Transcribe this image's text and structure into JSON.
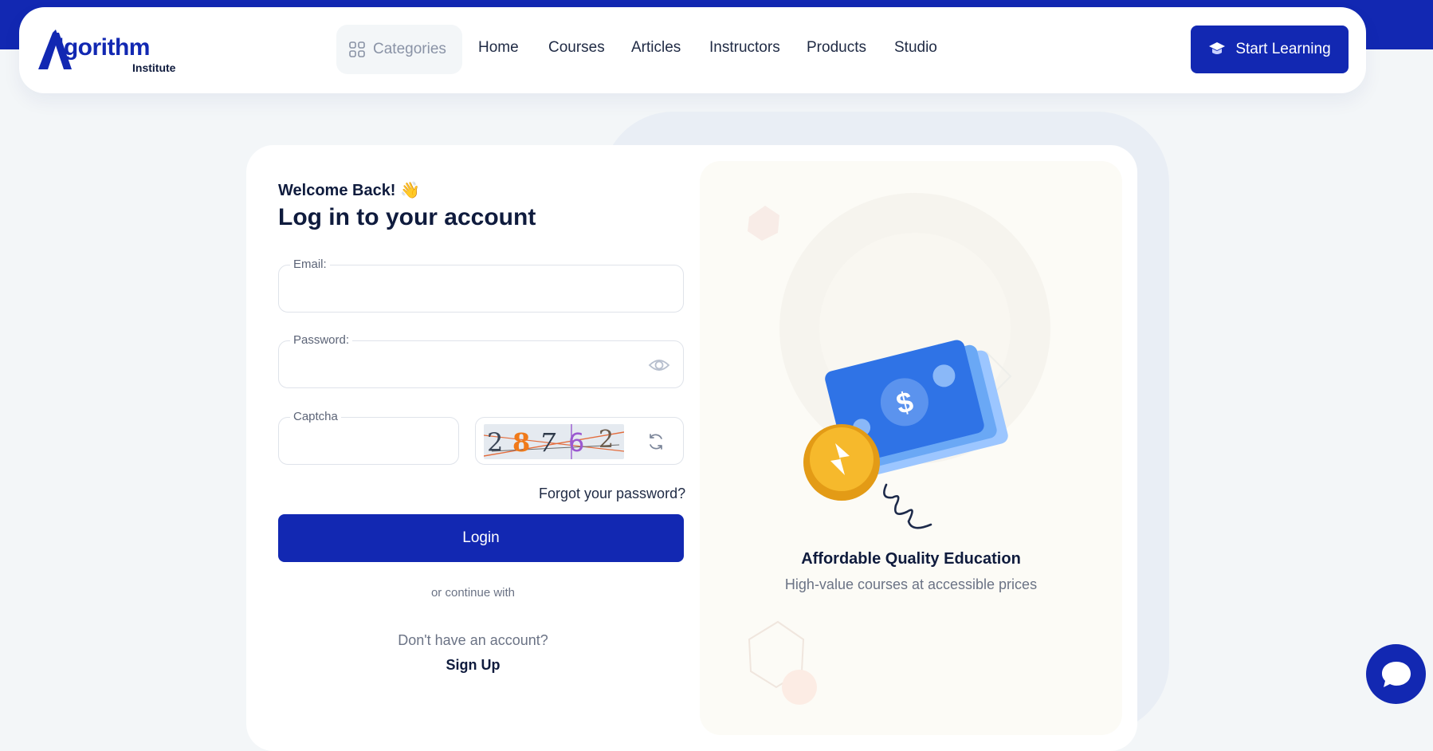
{
  "brand": {
    "name": "lgorithm",
    "subtitle": "Institute",
    "accent": "#1228b2"
  },
  "nav": {
    "categories_label": "Categories",
    "links": [
      "Home",
      "Courses",
      "Articles",
      "Instructors",
      "Products",
      "Studio"
    ],
    "cta_label": "Start Learning"
  },
  "login": {
    "welcome": "Welcome Back! 👋",
    "title": "Log in to your account",
    "email_label": "Email:",
    "email_value": "",
    "password_label": "Password:",
    "password_value": "",
    "captcha_label": "Captcha",
    "captcha_value": "",
    "captcha_code": [
      "2",
      "8",
      "7",
      "6",
      "2"
    ],
    "forgot_label": "Forgot your password?",
    "login_label": "Login",
    "or_continue": "or continue with",
    "no_account": "Don't have an account?",
    "signup_label": "Sign Up"
  },
  "promo": {
    "title": "Affordable Quality Education",
    "subtitle": "High-value courses at accessible prices",
    "icon": "money-coin-illustration"
  },
  "icons": {
    "categories": "grid-icon",
    "cta": "graduation-cap-icon",
    "password": "eye-icon",
    "captcha_refresh": "refresh-icon",
    "chat": "chat-bubble-icon"
  }
}
